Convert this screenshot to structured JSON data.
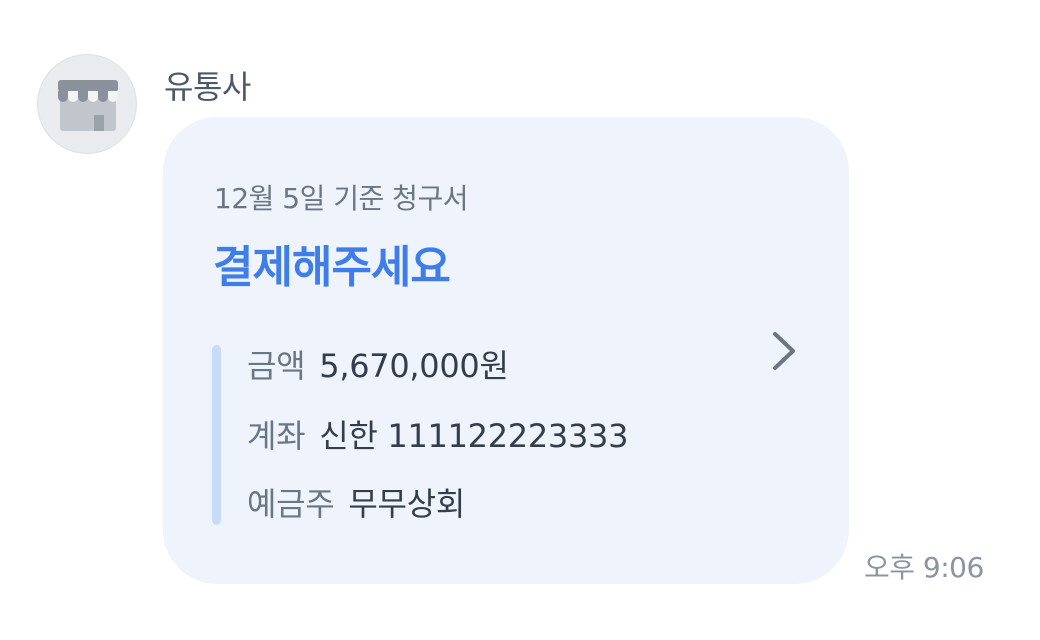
{
  "message": {
    "sender_name": "유통사",
    "avatar_icon": "store-icon",
    "timestamp": "오후 9:06"
  },
  "card": {
    "subtitle": "12월 5일 기준 청구서",
    "headline": "결제해주세요",
    "chevron_icon": "chevron-right-icon",
    "rows": [
      {
        "label": "금액",
        "value": "5,670,000원"
      },
      {
        "label": "계좌",
        "value": "신한 111122223333"
      },
      {
        "label": "예금주",
        "value": "무무상회"
      }
    ]
  },
  "colors": {
    "bubble_background": "#eff4fc",
    "headline": "#3f7de8",
    "accent_bar": "#c9dbfa",
    "label": "#6b7684",
    "value": "#333d4b"
  }
}
